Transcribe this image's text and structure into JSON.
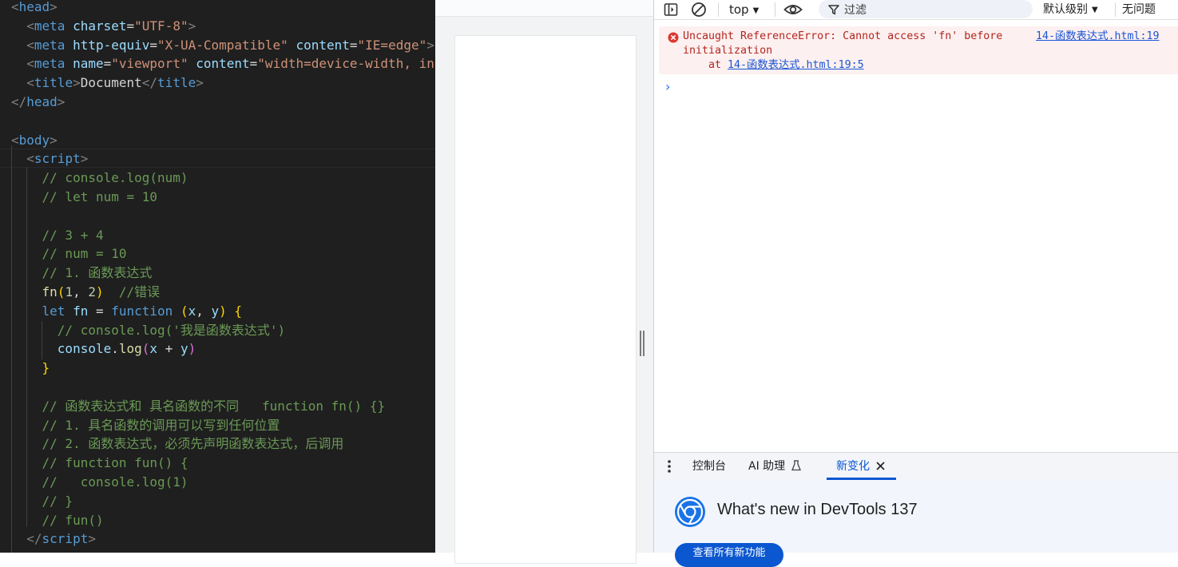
{
  "editor": {
    "lines": [
      [
        [
          "c-bracket-tag",
          "<"
        ],
        [
          "c-tag",
          "head"
        ],
        [
          "c-bracket-tag",
          ">"
        ]
      ],
      [
        [
          "c-text",
          "  "
        ],
        [
          "c-bracket-tag",
          "<"
        ],
        [
          "c-tag",
          "meta "
        ],
        [
          "c-attr",
          "charset"
        ],
        [
          "c-text",
          "="
        ],
        [
          "c-str",
          "\"UTF-8\""
        ],
        [
          "c-bracket-tag",
          ">"
        ]
      ],
      [
        [
          "c-text",
          "  "
        ],
        [
          "c-bracket-tag",
          "<"
        ],
        [
          "c-tag",
          "meta "
        ],
        [
          "c-attr",
          "http-equiv"
        ],
        [
          "c-text",
          "="
        ],
        [
          "c-str",
          "\"X-UA-Compatible\""
        ],
        [
          "c-text",
          " "
        ],
        [
          "c-attr",
          "content"
        ],
        [
          "c-text",
          "="
        ],
        [
          "c-str",
          "\"IE=edge\""
        ],
        [
          "c-bracket-tag",
          ">"
        ]
      ],
      [
        [
          "c-text",
          "  "
        ],
        [
          "c-bracket-tag",
          "<"
        ],
        [
          "c-tag",
          "meta "
        ],
        [
          "c-attr",
          "name"
        ],
        [
          "c-text",
          "="
        ],
        [
          "c-str",
          "\"viewport\""
        ],
        [
          "c-text",
          " "
        ],
        [
          "c-attr",
          "content"
        ],
        [
          "c-text",
          "="
        ],
        [
          "c-str",
          "\"width=device-width, ini"
        ]
      ],
      [
        [
          "c-text",
          "  "
        ],
        [
          "c-bracket-tag",
          "<"
        ],
        [
          "c-tag",
          "title"
        ],
        [
          "c-bracket-tag",
          ">"
        ],
        [
          "c-text",
          "Document"
        ],
        [
          "c-bracket-tag",
          "</"
        ],
        [
          "c-tag",
          "title"
        ],
        [
          "c-bracket-tag",
          ">"
        ]
      ],
      [
        [
          "c-bracket-tag",
          "</"
        ],
        [
          "c-tag",
          "head"
        ],
        [
          "c-bracket-tag",
          ">"
        ]
      ],
      [],
      [
        [
          "c-bracket-tag",
          "<"
        ],
        [
          "c-tag",
          "body"
        ],
        [
          "c-bracket-tag",
          ">"
        ]
      ],
      [
        [
          "c-text",
          "  "
        ],
        [
          "c-bracket-tag",
          "<"
        ],
        [
          "c-tag",
          "script"
        ],
        [
          "c-bracket-tag",
          ">"
        ]
      ],
      [
        [
          "c-text",
          "    "
        ],
        [
          "c-cm",
          "// console.log(num)"
        ]
      ],
      [
        [
          "c-text",
          "    "
        ],
        [
          "c-cm",
          "// let num = 10"
        ]
      ],
      [],
      [
        [
          "c-text",
          "    "
        ],
        [
          "c-cm",
          "// 3 + 4"
        ]
      ],
      [
        [
          "c-text",
          "    "
        ],
        [
          "c-cm",
          "// num = 10"
        ]
      ],
      [
        [
          "c-text",
          "    "
        ],
        [
          "c-cm",
          "// 1. 函数表达式"
        ]
      ],
      [
        [
          "c-text",
          "    "
        ],
        [
          "c-fn",
          "fn"
        ],
        [
          "c-b1",
          "("
        ],
        [
          "c-num",
          "1"
        ],
        [
          "c-text",
          ", "
        ],
        [
          "c-num",
          "2"
        ],
        [
          "c-b1",
          ")"
        ],
        [
          "c-text",
          "  "
        ],
        [
          "c-cm",
          "//错误"
        ]
      ],
      [
        [
          "c-text",
          "    "
        ],
        [
          "c-kw",
          "let "
        ],
        [
          "c-var",
          "fn"
        ],
        [
          "c-op",
          " = "
        ],
        [
          "c-kw",
          "function "
        ],
        [
          "c-b1",
          "("
        ],
        [
          "c-var",
          "x"
        ],
        [
          "c-text",
          ", "
        ],
        [
          "c-var",
          "y"
        ],
        [
          "c-b1",
          ")"
        ],
        [
          "c-text",
          " "
        ],
        [
          "c-b1",
          "{"
        ]
      ],
      [
        [
          "c-text",
          "      "
        ],
        [
          "c-cm",
          "// console.log('我是函数表达式')"
        ]
      ],
      [
        [
          "c-text",
          "      "
        ],
        [
          "c-var",
          "console"
        ],
        [
          "c-text",
          "."
        ],
        [
          "c-fn",
          "log"
        ],
        [
          "c-b2",
          "("
        ],
        [
          "c-var",
          "x"
        ],
        [
          "c-op",
          " + "
        ],
        [
          "c-var",
          "y"
        ],
        [
          "c-b2",
          ")"
        ]
      ],
      [
        [
          "c-text",
          "    "
        ],
        [
          "c-b1",
          "}"
        ]
      ],
      [],
      [
        [
          "c-text",
          "    "
        ],
        [
          "c-cm",
          "// 函数表达式和 具名函数的不同   function fn() {}"
        ]
      ],
      [
        [
          "c-text",
          "    "
        ],
        [
          "c-cm",
          "// 1. 具名函数的调用可以写到任何位置"
        ]
      ],
      [
        [
          "c-text",
          "    "
        ],
        [
          "c-cm",
          "// 2. 函数表达式，必须先声明函数表达式，后调用"
        ]
      ],
      [
        [
          "c-text",
          "    "
        ],
        [
          "c-cm",
          "// function fun() {"
        ]
      ],
      [
        [
          "c-text",
          "    "
        ],
        [
          "c-cm",
          "//   console.log(1)"
        ]
      ],
      [
        [
          "c-text",
          "    "
        ],
        [
          "c-cm",
          "// }"
        ]
      ],
      [
        [
          "c-text",
          "    "
        ],
        [
          "c-cm",
          "// fun()"
        ]
      ],
      [
        [
          "c-text",
          "  "
        ],
        [
          "c-bracket-tag",
          "</"
        ],
        [
          "c-tag",
          "script"
        ],
        [
          "c-bracket-tag",
          ">"
        ]
      ],
      [
        [
          "c-bracket-tag",
          "</"
        ],
        [
          "c-tag",
          "body"
        ],
        [
          "c-bracket-tag",
          ">"
        ]
      ]
    ]
  },
  "devtools": {
    "context": "top",
    "filter_placeholder": "过滤",
    "level": "默认级别",
    "issues": "无问题",
    "error": {
      "message": "Uncaught ReferenceError: Cannot access 'fn' before\ninitialization",
      "source": "14-函数表达式.html:19",
      "at_prefix": "at ",
      "at_link": "14-函数表达式.html:19:5"
    },
    "prompt": "›",
    "drawer_tabs": {
      "console": "控制台",
      "ai": "AI 助理",
      "whatsnew": "新变化"
    },
    "whatsnew_title": "What's new in DevTools 137",
    "whatsnew_button": "查看所有新功能"
  },
  "colors": {
    "editor_bg": "#1f1f1f",
    "error_bg": "#fdf0f0",
    "error_text": "#b3261e",
    "link": "#1a56d6",
    "accent": "#0b57d0"
  }
}
